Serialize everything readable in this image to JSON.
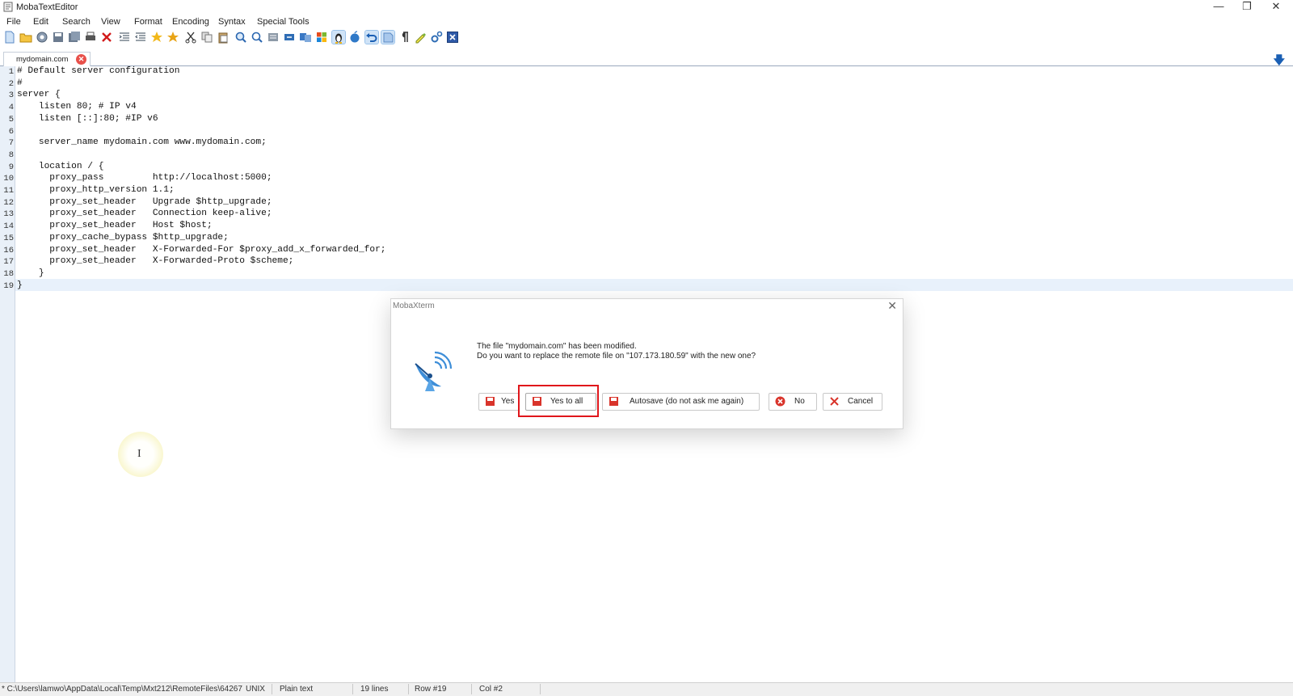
{
  "window": {
    "title": "MobaTextEditor",
    "controls": [
      "minimize",
      "restore",
      "close"
    ]
  },
  "menu": [
    "File",
    "Edit",
    "Search",
    "View",
    "Format",
    "Encoding",
    "Syntax",
    "Special Tools"
  ],
  "tab": {
    "label": "mydomain.com"
  },
  "editor": {
    "lines": [
      "# Default server configuration",
      "#",
      "server {",
      "    listen 80; # IP v4",
      "    listen [::]:80; #IP v6",
      "",
      "    server_name mydomain.com www.mydomain.com;",
      "",
      "    location / {",
      "      proxy_pass         http://localhost:5000;",
      "      proxy_http_version 1.1;",
      "      proxy_set_header   Upgrade $http_upgrade;",
      "      proxy_set_header   Connection keep-alive;",
      "      proxy_set_header   Host $host;",
      "      proxy_cache_bypass $http_upgrade;",
      "      proxy_set_header   X-Forwarded-For $proxy_add_x_forwarded_for;",
      "      proxy_set_header   X-Forwarded-Proto $scheme;",
      "    }",
      "}"
    ],
    "current_line": 19
  },
  "dialog": {
    "title": "MobaXterm",
    "message_line1": "The file \"mydomain.com\" has been modified.",
    "message_line2": "Do you want to replace the remote file on \"107.173.180.59\" with the new one?",
    "buttons": {
      "yes": "Yes",
      "yes_all": "Yes to all",
      "autosave": "Autosave (do not ask me again)",
      "no": "No",
      "cancel": "Cancel"
    },
    "highlight_color": "#e0161b"
  },
  "status": {
    "path": "* C:\\Users\\lamwo\\AppData\\Local\\Temp\\Mxt212\\RemoteFiles\\64267",
    "eol": "UNIX",
    "syntax": "Plain text",
    "lines": "19 lines",
    "row": "Row #19",
    "col": "Col #2"
  }
}
